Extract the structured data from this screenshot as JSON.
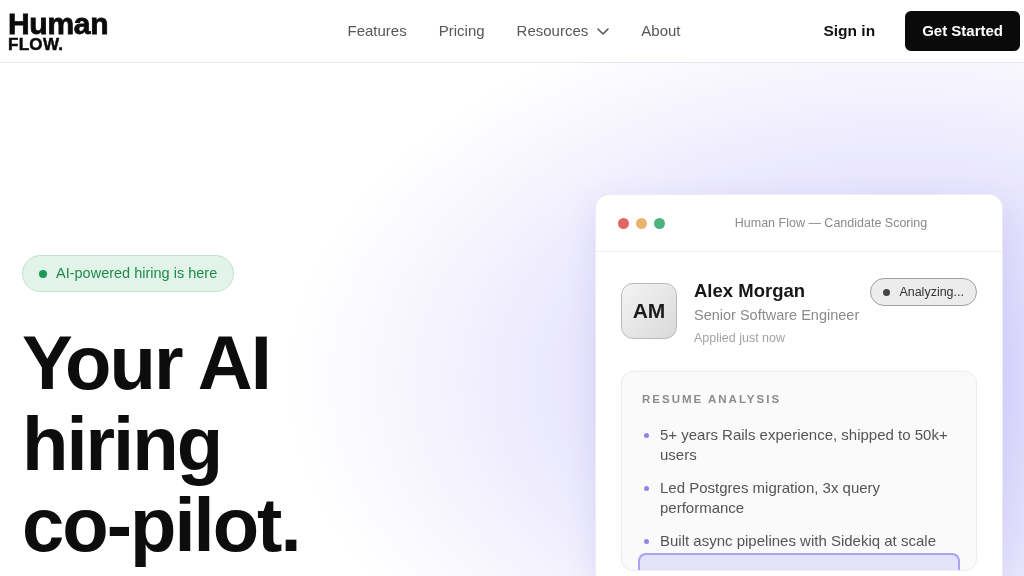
{
  "nav": {
    "logo": {
      "line_1": "Human",
      "line_2": "FLOW."
    },
    "links": [
      {
        "label": "Features",
        "kind": "link"
      },
      {
        "label": "Pricing",
        "kind": "link"
      },
      {
        "label": "Resources",
        "kind": "dropdown"
      },
      {
        "label": "About",
        "kind": "link"
      }
    ],
    "sign_in": "Sign in",
    "cta": "Get Started"
  },
  "hero": {
    "badge": "AI-powered hiring is here",
    "headline": "Your AI hiring co-pilot."
  },
  "app_window": {
    "title": "Human Flow — Candidate Scoring",
    "window_controls": [
      {
        "color": "#e06666"
      },
      {
        "color": "#e9b46b"
      },
      {
        "color": "#4db37e"
      }
    ],
    "candidate": {
      "initials": "AM",
      "name": "Alex Morgan",
      "role": "Senior Software Engineer",
      "applied": "Applied just now",
      "status": "Analyzing..."
    },
    "resume_analysis": {
      "heading": "RESUME ANALYSIS",
      "items": [
        "5+ years Rails experience, shipped to 50k+ users",
        "Led Postgres migration, 3x query performance",
        "Built async pipelines with Sidekiq at scale"
      ]
    }
  }
}
